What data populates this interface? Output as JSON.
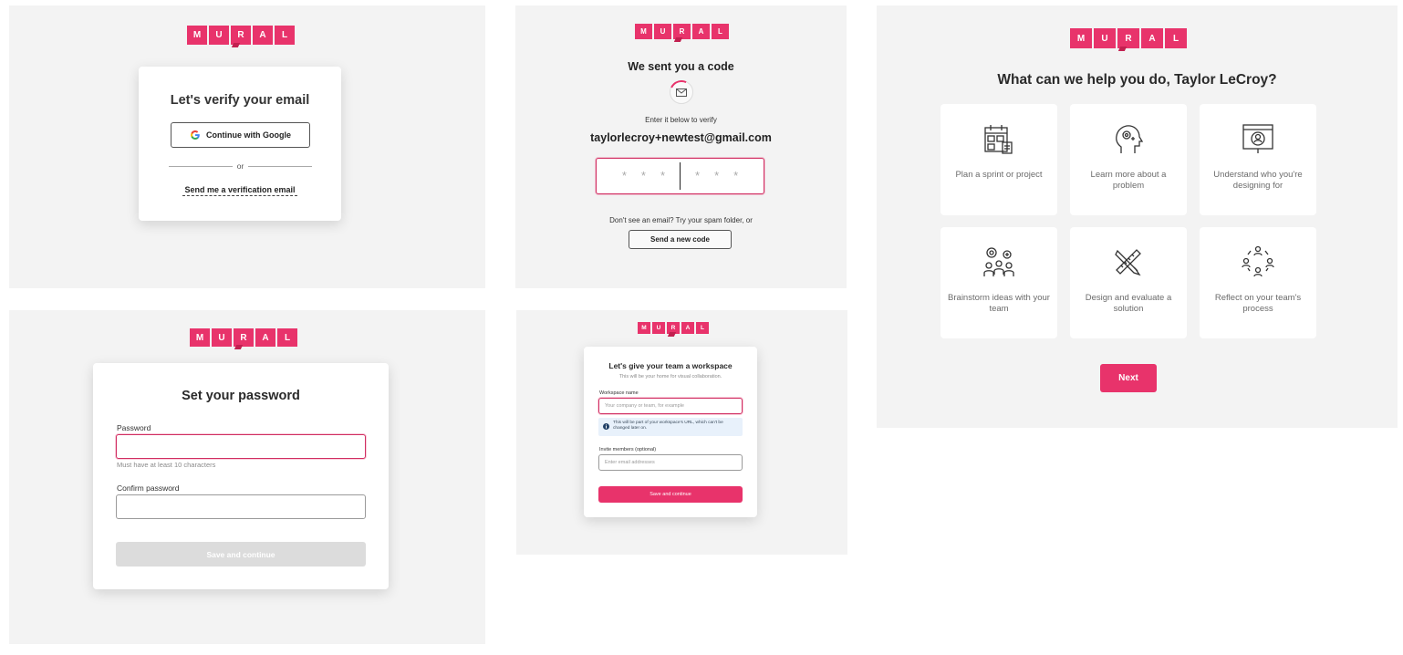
{
  "brand": {
    "logo_letters": [
      "M",
      "U",
      "R",
      "A",
      "L"
    ],
    "accent": "#e8336b"
  },
  "verify_email": {
    "title": "Let's verify your email",
    "google_button": "Continue with Google",
    "google_icon": "google-g-icon",
    "divider_text": "or",
    "email_link": "Send me a verification email"
  },
  "code": {
    "title": "We sent you a code",
    "icon": "envelope-icon",
    "instruction": "Enter it below to verify",
    "email": "taylorlecroy+newtest@gmail.com",
    "code_placeholder": [
      "*",
      "*",
      "*",
      "*",
      "*",
      "*"
    ],
    "spam_text": "Don't see an email? Try your spam folder, or",
    "resend_button": "Send a new code"
  },
  "password": {
    "title": "Set your password",
    "password_label": "Password",
    "password_value": "",
    "password_hint": "Must have at least 10 characters",
    "confirm_label": "Confirm password",
    "confirm_value": "",
    "submit": "Save and continue"
  },
  "workspace": {
    "title": "Let's give your team a workspace",
    "subtitle": "This will be your home for visual collaboration.",
    "name_label": "Workspace name",
    "name_placeholder": "Your company or team, for example",
    "info_icon": "info-icon",
    "info_text": "This will be part of your workspace's URL, which can't be changed later on.",
    "invite_label": "Invite members (optional)",
    "invite_placeholder": "Enter email addresses",
    "submit": "Save and continue"
  },
  "help": {
    "title": "What can we help you do, Taylor LeCroy?",
    "options": [
      {
        "label": "Plan a sprint or project",
        "icon": "calendar-plan-icon"
      },
      {
        "label": "Learn more about a problem",
        "icon": "head-gear-icon"
      },
      {
        "label": "Understand who you're designing for",
        "icon": "persona-screen-icon"
      },
      {
        "label": "Brainstorm ideas with your team",
        "icon": "brainstorm-team-icon"
      },
      {
        "label": "Design and evaluate a solution",
        "icon": "pencil-ruler-icon"
      },
      {
        "label": "Reflect on your team's process",
        "icon": "team-cycle-icon"
      }
    ],
    "next_button": "Next"
  }
}
